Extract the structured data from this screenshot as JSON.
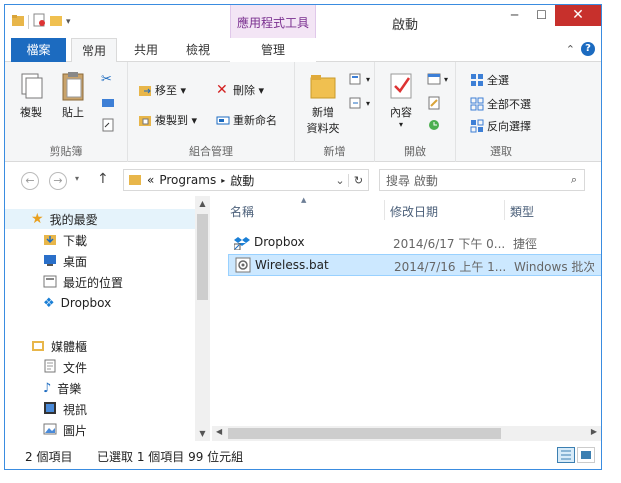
{
  "window": {
    "title": "啟動",
    "context_tab_group": "應用程式工具"
  },
  "tabs": {
    "file": "檔案",
    "home": "常用",
    "share": "共用",
    "view": "檢視",
    "manage": "管理"
  },
  "ribbon": {
    "clipboard": {
      "label": "剪貼簿",
      "copy": "複製",
      "paste": "貼上"
    },
    "organize": {
      "label": "組合管理",
      "move_to": "移至 ▾",
      "copy_to": "複製到 ▾",
      "delete": "刪除 ▾",
      "rename": "重新命名"
    },
    "new": {
      "label": "新增",
      "new_folder_line1": "新增",
      "new_folder_line2": "資料夾"
    },
    "open": {
      "label": "開啟",
      "properties": "內容"
    },
    "select": {
      "label": "選取",
      "select_all": "全選",
      "select_none": "全部不選",
      "invert": "反向選擇"
    }
  },
  "address": {
    "prefix": "«",
    "crumb1": "Programs",
    "sep": "▸",
    "crumb2": "啟動",
    "search_placeholder": "搜尋 啟動"
  },
  "nav": {
    "favorites": "我的最愛",
    "downloads": "下載",
    "desktop": "桌面",
    "recent": "最近的位置",
    "dropbox": "Dropbox",
    "libraries": "媒體櫃",
    "documents": "文件",
    "music": "音樂",
    "videos": "視訊",
    "pictures": "圖片"
  },
  "columns": {
    "name": "名稱",
    "date": "修改日期",
    "type": "類型"
  },
  "files": [
    {
      "name": "Dropbox",
      "date": "2014/6/17 下午 0...",
      "type": "捷徑"
    },
    {
      "name": "Wireless.bat",
      "date": "2014/7/16 上午 1...",
      "type": "Windows 批次檔"
    }
  ],
  "status": {
    "count": "2 個項目",
    "selected": "已選取 1 個項目 99 位元組"
  },
  "colors": {
    "accent": "#1c6bc0",
    "close": "#c7302c",
    "selection": "#cce8ff"
  }
}
